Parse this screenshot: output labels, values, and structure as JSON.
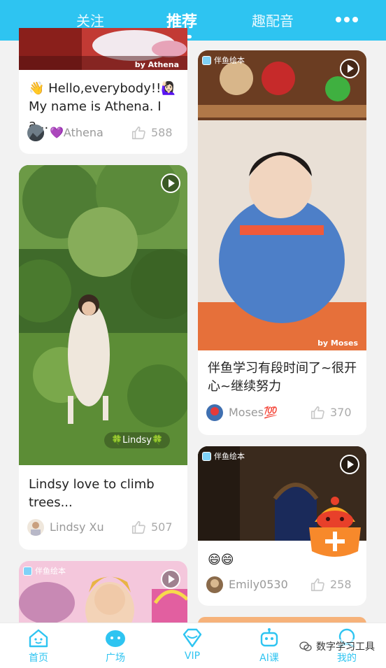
{
  "top_tabs": [
    {
      "label": "关注"
    },
    {
      "label": "推荐"
    },
    {
      "label": "趣配音"
    }
  ],
  "colors": {
    "accent": "#2ec4f1",
    "fab": "#f7892b"
  },
  "feed": {
    "card1": {
      "title": "👋 Hello,everybody!!🙋🏻‍♀️ My name is Athena. I a...",
      "author": "💜Athena",
      "likes": "588",
      "by_tag": "by  Athena"
    },
    "card2": {
      "title": "Lindsy love to climb trees...",
      "author": "Lindsy Xu",
      "likes": "507",
      "video_label": "🍀Lindsy🍀"
    },
    "card3": {
      "brand": "伴鱼绘本"
    },
    "card4": {
      "brand": "伴鱼绘本",
      "title": "伴鱼学习有段时间了~很开心~继续努力",
      "author": "Moses💯",
      "likes": "370",
      "by_tag": "by Moses"
    },
    "card5": {
      "brand": "伴鱼绘本",
      "title": "😄😄",
      "author": "Emily0530",
      "likes": "258"
    }
  },
  "bottom_nav": [
    {
      "label": "首页",
      "icon": "home-icon"
    },
    {
      "label": "广场",
      "icon": "square-icon"
    },
    {
      "label": "VIP",
      "icon": "vip-diamond-icon"
    },
    {
      "label": "AI课",
      "icon": "robot-icon"
    },
    {
      "label": "我的",
      "icon": "profile-icon"
    }
  ],
  "watermark": "数字学习工具"
}
